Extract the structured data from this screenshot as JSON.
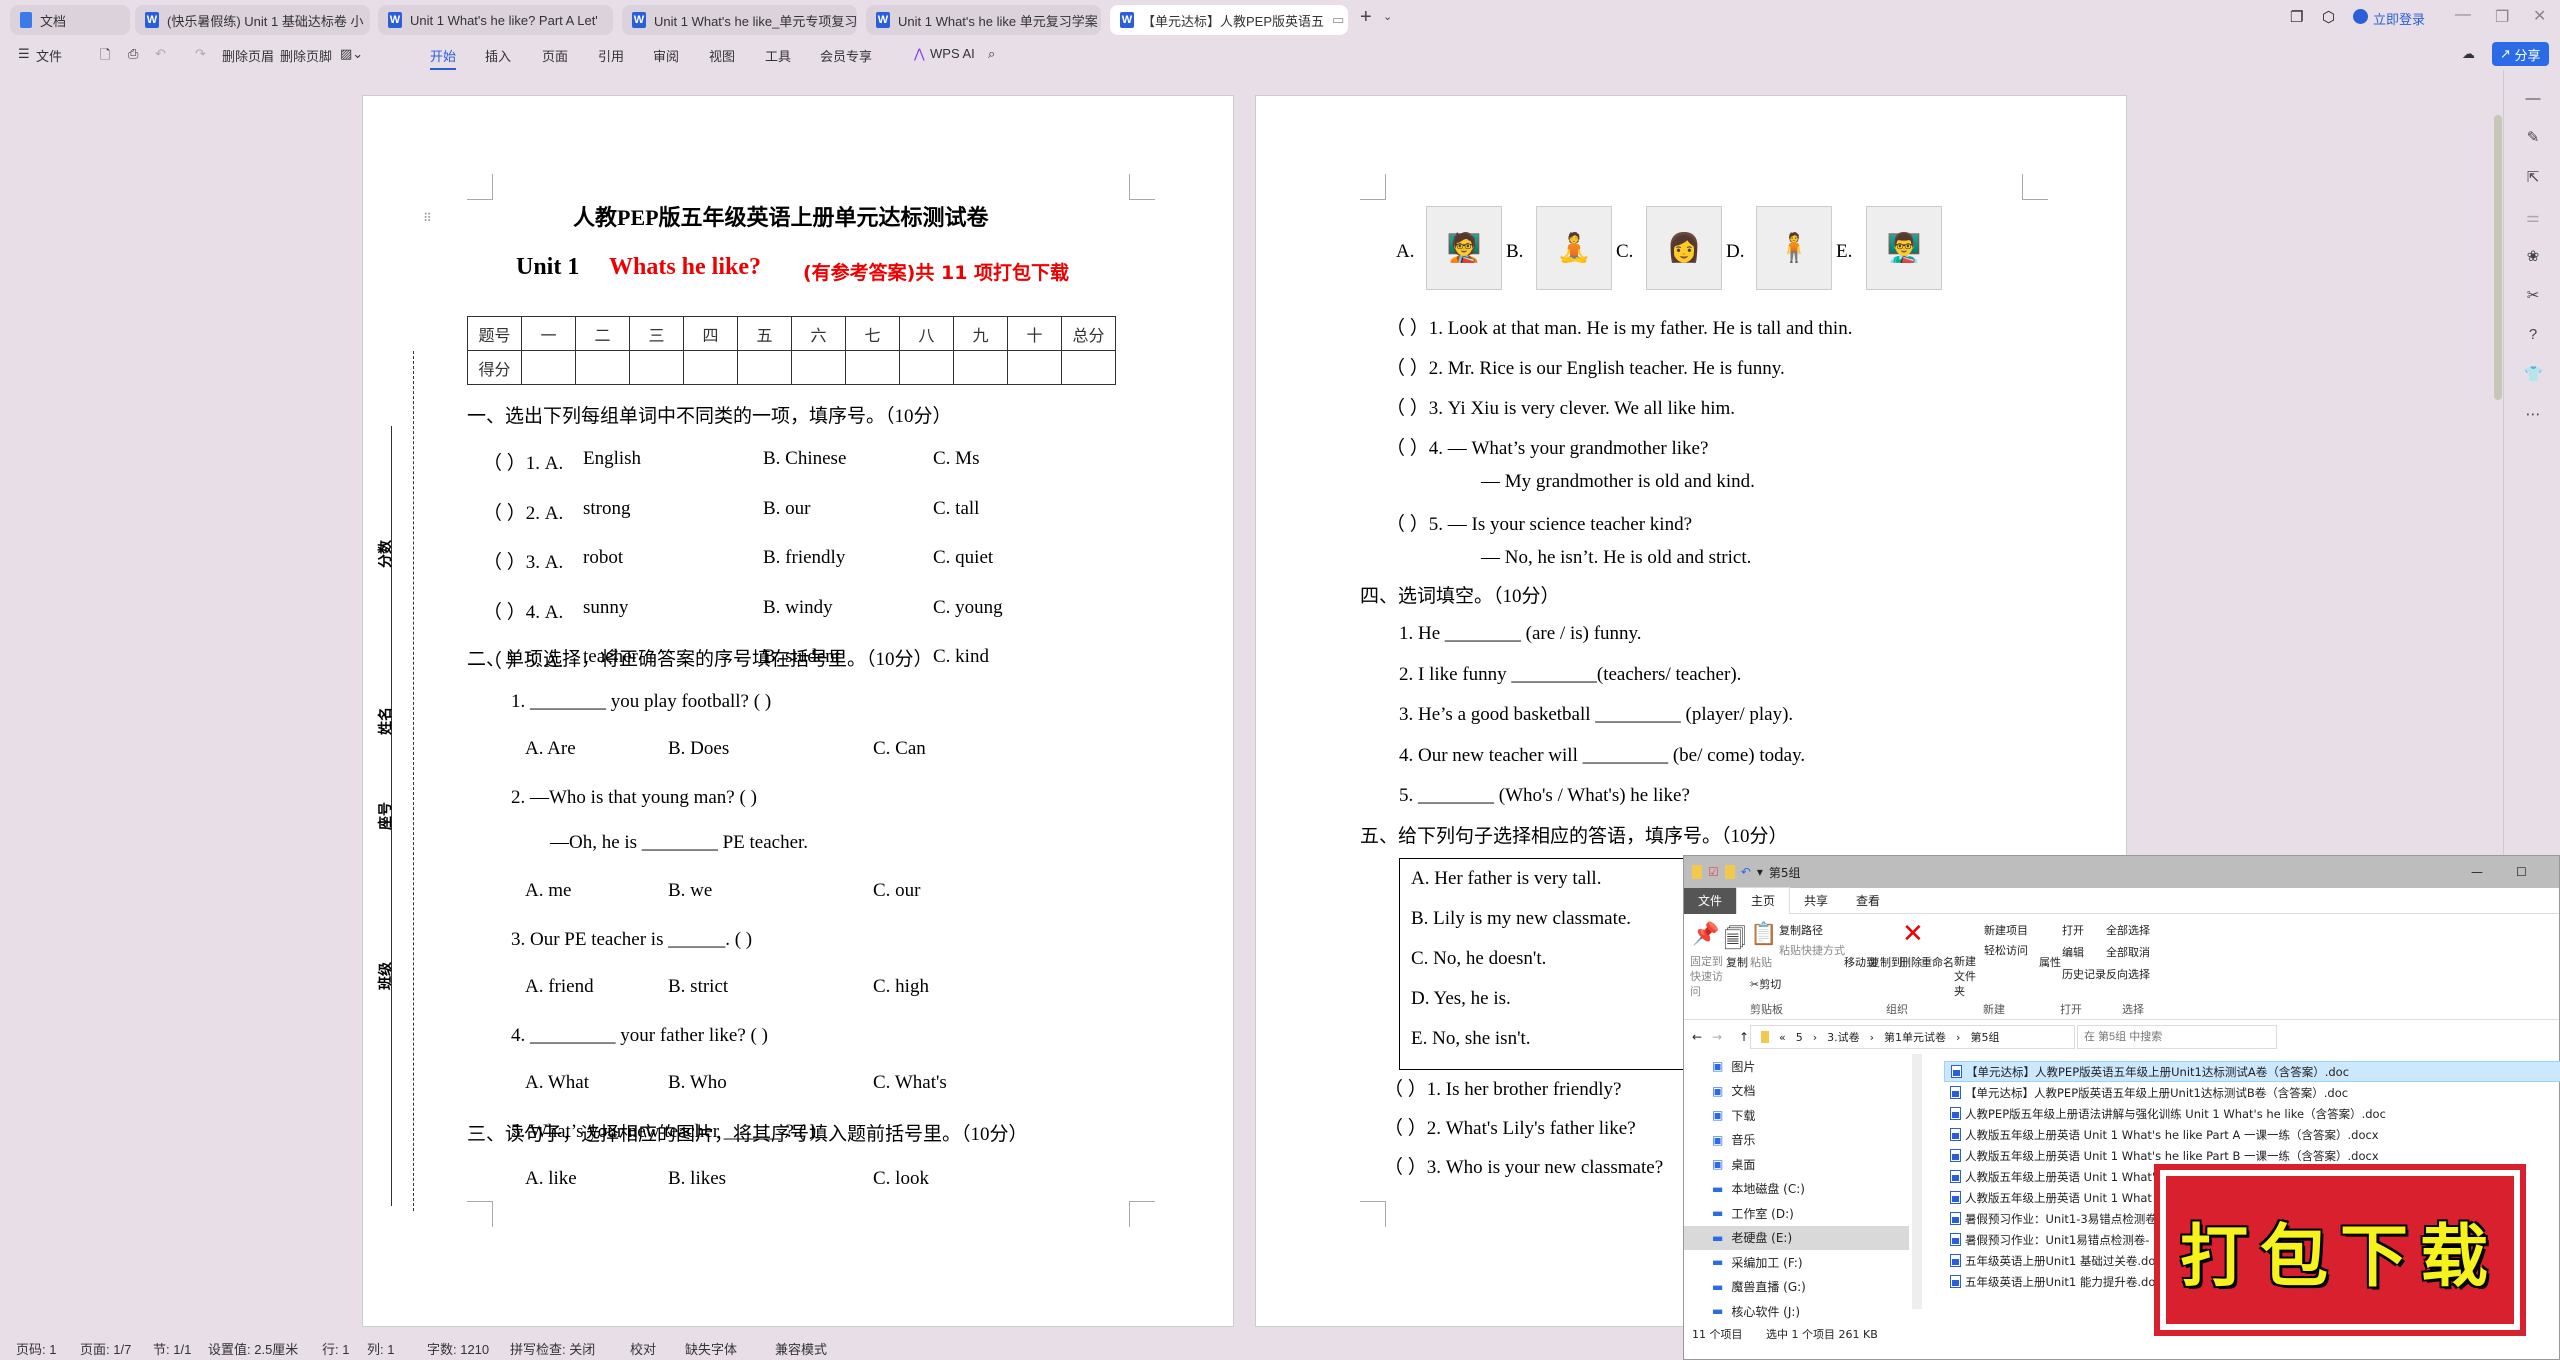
{
  "tabs": [
    {
      "label": "文档",
      "icon": "docs-icon"
    },
    {
      "label": "(快乐暑假练) Unit 1 基础达标卷 小",
      "icon": "wps-writer-icon"
    },
    {
      "label": "Unit 1 What's he like?   Part A Let'",
      "icon": "wps-writer-icon"
    },
    {
      "label": "Unit 1 What's he like_单元专项复习",
      "icon": "wps-writer-icon"
    },
    {
      "label": "Unit 1 What's he like  单元复习学案",
      "icon": "wps-writer-icon"
    },
    {
      "label": "【单元达标】人教PEP版英语五",
      "icon": "wps-writer-icon",
      "active": true
    }
  ],
  "titlebar": {
    "login": "立即登录",
    "share": "分享"
  },
  "toolbar": {
    "file": "文件",
    "delete_header": "删除页眉",
    "delete_footer": "删除页脚",
    "menus": [
      "开始",
      "插入",
      "页面",
      "引用",
      "审阅",
      "视图",
      "工具",
      "会员专享"
    ],
    "wps_ai": "WPS AI"
  },
  "left_page": {
    "title": "人教PEP版五年级英语上册单元达标测试卷",
    "subtitle_unit": "Unit 1",
    "subtitle_red": "Whats he like?",
    "subtitle_note": "(有参考答案)共 11 项打包下载",
    "score_table": {
      "headers": [
        "题号",
        "一",
        "二",
        "三",
        "四",
        "五",
        "六",
        "七",
        "八",
        "九",
        "十",
        "总分"
      ],
      "row_label": "得分"
    },
    "side_labels": [
      "分数",
      "姓名",
      "座号",
      "班级"
    ],
    "section1": {
      "heading": "一、选出下列每组单词中不同类的一项，填序号。（10分）",
      "items": [
        {
          "n": "1",
          "a": "English",
          "b": "Chinese",
          "c": "Ms"
        },
        {
          "n": "2",
          "a": "strong",
          "b": "our",
          "c": "tall"
        },
        {
          "n": "3",
          "a": "robot",
          "b": "friendly",
          "c": "quiet"
        },
        {
          "n": "4",
          "a": "sunny",
          "b": "windy",
          "c": "young"
        },
        {
          "n": "5",
          "a": "teacher",
          "b": "student",
          "c": "kind"
        }
      ]
    },
    "section2": {
      "heading": "二、单项选择，将正确答案的序号填在括号里。（10分）",
      "items": [
        {
          "q": "1.    ________ you play football? (        )",
          "a": "A.  Are",
          "b": "B.  Does",
          "c": "C.  Can"
        },
        {
          "q": "2.    —Who is that young man? (        )",
          "q2": "—Oh, he is ________ PE teacher.",
          "a": "A.  me",
          "b": "B.  we",
          "c": "C.  our"
        },
        {
          "q": "3.    Our PE teacher is ______. (       )",
          "a": "A.  friend",
          "b": "B.  strict",
          "c": "C.  high"
        },
        {
          "q": "4.    _________ your father like? (        )",
          "a": "A.  What",
          "b": "B.  Who",
          "c": "C.  What's"
        },
        {
          "q": "5.    What’s your new teacher ______ ? (          )",
          "a": "A.  like",
          "b": "B.  likes",
          "c": "C.  look"
        }
      ]
    },
    "section3_heading": "三、读句子，选择相应的图片，将其序号填入题前括号里。（10分）"
  },
  "right_page": {
    "pictures": [
      "A.",
      "B.",
      "C.",
      "D.",
      "E."
    ],
    "section3_items": [
      "（      ）1.  Look at that man. He is my father. He is tall and thin.",
      "（      ）2.  Mr. Rice is our English teacher. He is funny.",
      "（      ）3.  Yi Xiu is very clever. We all like him.",
      "（      ）4.  — What’s your grandmother like?",
      "— My grandmother is old and kind.",
      "（      ）5.  — Is your science teacher kind?",
      "— No, he isn’t. He is old and strict."
    ],
    "section4": {
      "heading": "四、选词填空。（10分）",
      "items": [
        "1.  He ________ (are / is) funny.",
        "2.  I like funny _________(teachers/ teacher).",
        "3.  He’s a good basketball _________ (player/ play).",
        "4.  Our new teacher will _________ (be/ come) today.",
        "5.  ________ (Who's / What's) he like?"
      ]
    },
    "section5": {
      "heading": "五、给下列句子选择相应的答语，填序号。（10分）",
      "options": [
        "A.  Her father is very tall.",
        "B.  Lily is my new classmate.",
        "C.  No, he doesn't.",
        "D.  Yes, he is.",
        "E.  No, she isn't."
      ],
      "items": [
        "（      ）1.  Is her brother friendly?",
        "（      ）2.  What's Lily's father like?",
        "（      ）3.  Who is your new classmate?"
      ]
    }
  },
  "statusbar": [
    "页码: 1",
    "页面: 1/7",
    "节: 1/1",
    "设置值: 2.5厘米",
    "行: 1",
    "列: 1",
    "字数: 1210",
    "拼写检查: 关闭",
    "校对",
    "缺失字体",
    "兼容模式"
  ],
  "explorer": {
    "title": "第5组",
    "menu": [
      "文件",
      "主页",
      "共享",
      "查看"
    ],
    "ribbon": {
      "pin": "固定到快速访问",
      "copy": "复制",
      "paste": "粘贴",
      "copy_path": "复制路径",
      "paste_shortcut": "粘贴快捷方式",
      "cut": "剪切",
      "move_to": "移动到",
      "copy_to": "复制到",
      "delete": "删除",
      "rename": "重命名",
      "new_folder": "新建文件夹",
      "new_item": "新建项目",
      "easy_access": "轻松访问",
      "properties": "属性",
      "open": "打开",
      "edit": "编辑",
      "history": "历史记录",
      "select_all": "全部选择",
      "select_none": "全部取消",
      "invert": "反向选择",
      "groups": [
        "剪贴板",
        "组织",
        "新建",
        "打开",
        "选择"
      ]
    },
    "breadcrumb": [
      "5",
      "3.试卷",
      "第1单元试卷",
      "第5组"
    ],
    "search_placeholder": "在 第5组 中搜索",
    "nav": [
      "图片",
      "文档",
      "下载",
      "音乐",
      "桌面",
      "本地磁盘 (C:)",
      "工作室 (D:)",
      "老硬盘 (E:)",
      "采编加工 (F:)",
      "魔兽直播 (G:)",
      "核心软件 (J:)"
    ],
    "files": [
      "【单元达标】人教PEP版英语五年级上册Unit1达标测试A卷（含答案）.doc",
      "【单元达标】人教PEP版英语五年级上册Unit1达标测试B卷（含答案）.doc",
      "人教PEP版五年级上册语法讲解与强化训练 Unit 1 What's he like（含答案）.doc",
      "人教版五年级上册英语 Unit 1  What's  he  like Part A 一课一练（含答案）.docx",
      "人教版五年级上册英语 Unit 1 What's  he  like Part B 一课一练（含答案）.docx",
      "人教版五年级上册英语 Unit 1 What's  he  li",
      "人教版五年级上册英语 Unit 1 What",
      "暑假预习作业：Unit1-3易错点检测卷",
      "暑假预习作业：Unit1易错点检测卷-",
      "五年级英语上册Unit1 基础过关卷.docx",
      "五年级英语上册Unit1 能力提升卷.docx"
    ],
    "status_count": "11 个项目",
    "status_selected": "选中 1 个项目  261 KB"
  },
  "stamp": "打包下载"
}
